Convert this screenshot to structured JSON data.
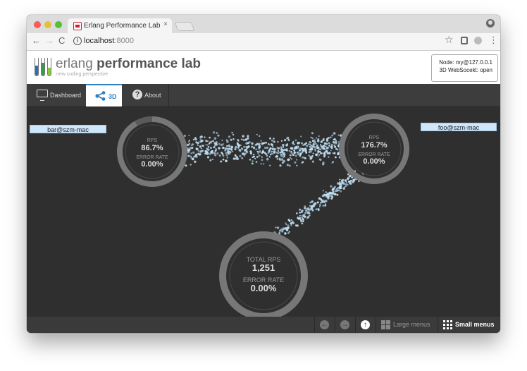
{
  "browser": {
    "tab_title": "Erlang Performance Lab - erla",
    "tab_close": "×",
    "url_host": "localhost",
    "url_port": ":8000",
    "nav_back": "←",
    "nav_forward": "→",
    "nav_reload": "C",
    "star": "☆",
    "menu": "⋮"
  },
  "header": {
    "brand_light": "erlang ",
    "brand_bold": "performance lab",
    "tagline": "new coding perspective",
    "logo_tube_colors": [
      "#2b6fb6",
      "#3a9a4c",
      "#8cc63f"
    ],
    "node_label": "Node: my@127.0.0.1",
    "websocket_status": "3D WebSocekt: open"
  },
  "tabs": [
    {
      "label": "Dashboard",
      "icon": "monitor-icon",
      "active": false
    },
    {
      "label": "3D",
      "icon": "share-icon",
      "active": true
    },
    {
      "label": "About",
      "icon": "help-icon",
      "active": false
    }
  ],
  "stage": {
    "nodes": [
      {
        "name": "bar@szm-mac",
        "metric1_label": "RPS",
        "metric1_value": "86.7%",
        "metric2_label": "ERROR RATE",
        "metric2_value": "0.00%",
        "load_fraction": 0.083
      },
      {
        "name": "foo@szm-mac",
        "metric1_label": "RPS",
        "metric1_value": "176.7%",
        "metric2_label": "ERROR RATE",
        "metric2_value": "0.00%",
        "load_fraction": 0.0
      }
    ],
    "total": {
      "metric1_label": "TOTAL RPS",
      "metric1_value": "1,251",
      "metric2_label": "ERROR RATE",
      "metric2_value": "0.00%"
    },
    "particle_color": "#bfe0f5"
  },
  "bottombar": {
    "back_icon": "arrow-left-circle-icon",
    "forward_icon": "arrow-right-circle-icon",
    "up_icon": "arrow-up-circle-icon",
    "large_menus": "Large menus",
    "small_menus": "Small menus",
    "small_active": true
  }
}
